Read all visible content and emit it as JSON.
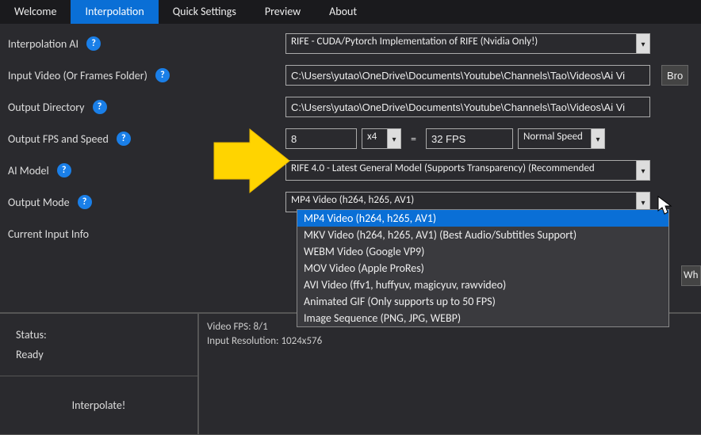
{
  "tabs": {
    "items": [
      {
        "label": "Welcome"
      },
      {
        "label": "Interpolation",
        "active": true
      },
      {
        "label": "Quick Settings"
      },
      {
        "label": "Preview"
      },
      {
        "label": "About"
      }
    ]
  },
  "form": {
    "interpolation_ai": {
      "label": "Interpolation AI",
      "value": "RIFE - CUDA/Pytorch Implementation of RIFE (Nvidia Only!)"
    },
    "input_video": {
      "label": "Input Video (Or Frames Folder)",
      "value": "C:\\Users\\yutao\\OneDrive\\Documents\\Youtube\\Channels\\Tao\\Videos\\Ai Vi",
      "browse": "Bro"
    },
    "output_directory": {
      "label": "Output Directory",
      "value": "C:\\Users\\yutao\\OneDrive\\Documents\\Youtube\\Channels\\Tao\\Videos\\Ai Vi"
    },
    "fps_speed": {
      "label": "Output FPS and Speed",
      "input_fps": "8",
      "multiplier": "x4",
      "equals": "=",
      "output_fps": "32 FPS",
      "speed": "Normal Speed"
    },
    "ai_model": {
      "label": "AI Model",
      "value": "RIFE 4.0 - Latest General Model (Supports Transparency) (Recommended"
    },
    "output_mode": {
      "label": "Output Mode",
      "value": "MP4 Video (h264, h265, AV1)",
      "options": [
        "MP4 Video (h264, h265, AV1)",
        "MKV Video (h264, h265, AV1) (Best Audio/Subtitles Support)",
        "WEBM Video (Google VP9)",
        "MOV Video (Apple ProRes)",
        "AVI Video (ffv1, huffyuv, magicyuv, rawvideo)",
        "Animated GIF (Only supports up to 50 FPS)",
        "Image Sequence (PNG, JPG, WEBP)"
      ]
    },
    "current_input_info": {
      "label": "Current Input Info"
    }
  },
  "status": {
    "label": "Status:",
    "value": "Ready"
  },
  "interpolate_button": "Interpolate!",
  "info_panel": {
    "line1": "Video FPS: 8/1",
    "line2": "Input Resolution: 1024x576"
  },
  "right_partial": "Wh",
  "help_glyph": "?"
}
